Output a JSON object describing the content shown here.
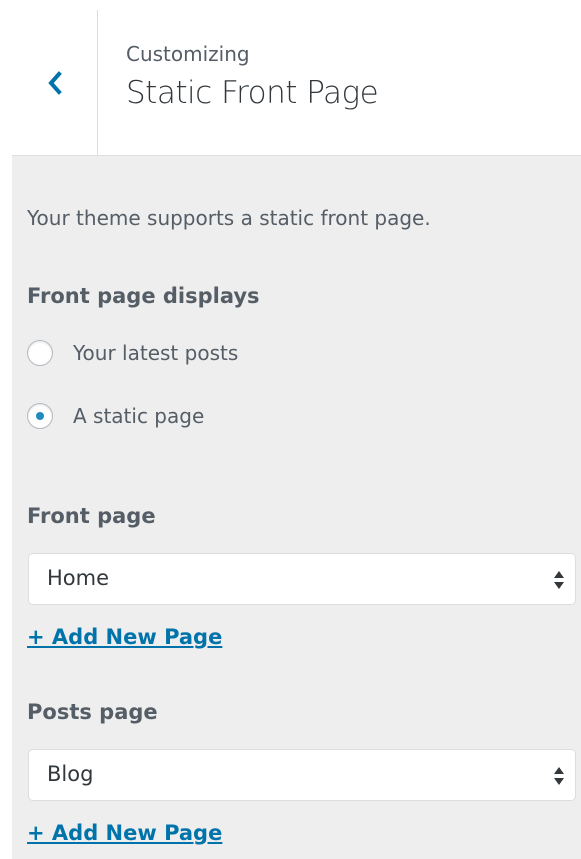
{
  "header": {
    "eyebrow": "Customizing",
    "title": "Static Front Page",
    "back_icon": "chevron-left-icon"
  },
  "section": {
    "description": "Your theme supports a static front page.",
    "front_page_displays_label": "Front page displays",
    "radio_options": [
      {
        "label": "Your latest posts",
        "checked": false
      },
      {
        "label": "A static page",
        "checked": true
      }
    ],
    "front_page": {
      "label": "Front page",
      "selected": "Home",
      "add_link": "+ Add New Page"
    },
    "posts_page": {
      "label": "Posts page",
      "selected": "Blog",
      "add_link": "+ Add New Page"
    }
  },
  "colors": {
    "accent": "#0073aa",
    "radio_dot": "#1e8cbe",
    "panel_bg": "#eeeeee"
  }
}
